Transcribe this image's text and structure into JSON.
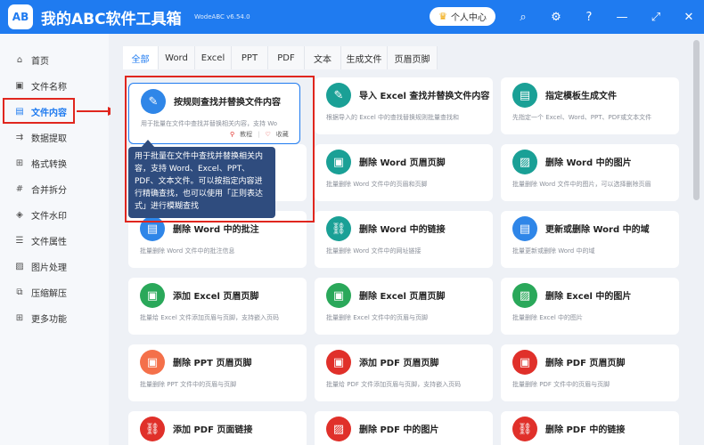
{
  "header": {
    "logo_text": "AB",
    "title": "我的ABC软件工具箱",
    "version": "WodeABC v6.54.0",
    "user_center": "个人中心",
    "crown_icon": "♛",
    "search_icon": "⌕",
    "settings_icon": "⚙",
    "help_icon": "?",
    "minimize_icon": "—",
    "maximize_icon": "⤢",
    "close_icon": "✕"
  },
  "sidebar": {
    "items": [
      {
        "label": "首页",
        "icon": "⌂"
      },
      {
        "label": "文件名称",
        "icon": "▣"
      },
      {
        "label": "文件内容",
        "icon": "▤"
      },
      {
        "label": "数据提取",
        "icon": "⇉"
      },
      {
        "label": "格式转换",
        "icon": "⊞"
      },
      {
        "label": "合并拆分",
        "icon": "#"
      },
      {
        "label": "文件水印",
        "icon": "◈"
      },
      {
        "label": "文件属性",
        "icon": "☰"
      },
      {
        "label": "图片处理",
        "icon": "▨"
      },
      {
        "label": "压缩解压",
        "icon": "⧉"
      },
      {
        "label": "更多功能",
        "icon": "⊞"
      }
    ]
  },
  "tabs": [
    "全部",
    "Word",
    "Excel",
    "PPT",
    "PDF",
    "文本",
    "生成文件",
    "页眉页脚"
  ],
  "cards": [
    {
      "title": "按规则查找并替换文件内容",
      "desc": "用于批量在文件中查找并替换相关内容，支持 Wo",
      "icon": "✎"
    },
    {
      "title": "导入 Excel 查找并替换文件内容",
      "desc": "根据导入的 Excel 中的查找替换规则批量查找和",
      "icon": "✎"
    },
    {
      "title": "指定模板生成文件",
      "desc": "先指定一个 Excel、Word、PPT、PDF或文本文件",
      "icon": "▤"
    },
    {
      "title": "",
      "desc": "",
      "icon": "▣"
    },
    {
      "title": "删除 Word 页眉页脚",
      "desc": "批量删除 Word 文件中的页眉和页脚",
      "icon": "▣"
    },
    {
      "title": "删除 Word 中的图片",
      "desc": "批量删除 Word 文件中的图片，可以选择删除页眉",
      "icon": "▨"
    },
    {
      "title": "删除 Word 中的批注",
      "desc": "批量删除 Word 文件中的批注信息",
      "icon": "▤"
    },
    {
      "title": "删除 Word 中的链接",
      "desc": "批量删除 Word 文件中的网址链接",
      "icon": "⛓"
    },
    {
      "title": "更新或删除 Word 中的域",
      "desc": "批量更新或删除 Word 中的域",
      "icon": "▤"
    },
    {
      "title": "添加 Excel 页眉页脚",
      "desc": "批量给 Excel 文件添加页眉与页脚，支持嵌入页码",
      "icon": "▣"
    },
    {
      "title": "删除 Excel 页眉页脚",
      "desc": "批量删除 Excel 文件中的页眉与页脚",
      "icon": "▣"
    },
    {
      "title": "删除 Excel 中的图片",
      "desc": "批量删除 Excel 中的图片",
      "icon": "▨"
    },
    {
      "title": "删除 PPT 页眉页脚",
      "desc": "批量删除 PPT 文件中的页眉与页脚",
      "icon": "▣"
    },
    {
      "title": "添加 PDF 页眉页脚",
      "desc": "批量给 PDF 文件添加页眉与页脚，支持嵌入页码",
      "icon": "▣"
    },
    {
      "title": "删除 PDF 页眉页脚",
      "desc": "批量删除 PDF 文件中的页眉与页脚",
      "icon": "▣"
    },
    {
      "title": "添加 PDF 页面链接",
      "desc": "",
      "icon": "⛓"
    },
    {
      "title": "删除 PDF 中的图片",
      "desc": "",
      "icon": "▨"
    },
    {
      "title": "删除 PDF 中的链接",
      "desc": "",
      "icon": "⛓"
    }
  ],
  "card_actions": {
    "tutorial": "教程",
    "favorite": "收藏"
  },
  "tooltip": "用于批量在文件中查找并替换相关内容，支持 Word、Excel、PPT、PDF、文本文件。可以按指定内容进行精确查找，也可以使用「正则表达式」进行模糊查找"
}
